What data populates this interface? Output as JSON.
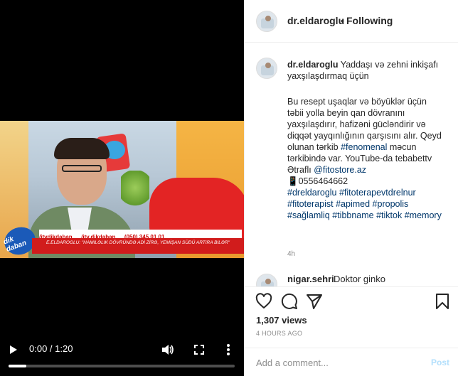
{
  "post": {
    "username": "dr.eldaroglu",
    "separator": "•",
    "follow_status": "Following"
  },
  "video": {
    "tv_logo_text": "dik daban",
    "banner_social": [
      "/itvdikdaban",
      "/itv.dikdaban",
      "(050) 345 01 01"
    ],
    "banner_caption": "E.ELDAROGLU: \"HAMILƏLIK DÖVRÜNDƏ ADİ ZİRƏ, YEMİŞAN SÜDÜ ARTIRA BILƏR\"",
    "time": "0:00 / 1:20",
    "progress_fraction": 0.08
  },
  "caption": {
    "username": "dr.eldaroglu",
    "intro": "Yaddaşı və zehni inkişafı yaxşılaşdırmaq üçün",
    "body": "Bu resept uşaqlar və böyüklər üçün təbii yolla beyin qan dövranını yaxşılaşdırır, hafizəni gücləndirir və diqqət yayqınlığının qarşısını alır. Qeyd olunan tərkib",
    "tag_fenomenal": "#fenomenal",
    "body2": "məcun tərkibində var. YouTube-da tebabettv",
    "etrafli": "Ətraflı",
    "mention": "@fitostore.az",
    "phone": "📱0556464662",
    "tags_line1": [
      "#dreldaroglu",
      "#fitoterapevtdrelnur"
    ],
    "tags_line2": [
      "#fitoterapist",
      "#apimed",
      "#propolis"
    ],
    "tags_line3": [
      "#sağlamliq",
      "#tibbname",
      "#tiktok"
    ],
    "tags_line4": [
      "#memory"
    ],
    "time_ago": "4h"
  },
  "comment_peek": {
    "username": "nigar.sehri",
    "text": "Doktor ginko"
  },
  "actions": {
    "icons": [
      "heart-icon",
      "comment-icon",
      "share-icon",
      "bookmark-icon"
    ],
    "views": "1,307 views",
    "posted": "4 HOURS AGO"
  },
  "comment_box": {
    "placeholder": "Add a comment...",
    "post_label": "Post"
  }
}
